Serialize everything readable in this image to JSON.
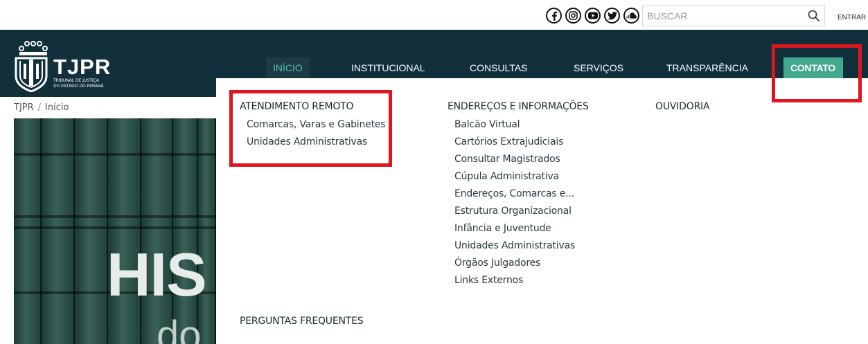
{
  "topbar": {
    "social_icons": [
      "facebook-icon",
      "instagram-icon",
      "youtube-icon",
      "twitter-icon",
      "soundcloud-icon"
    ],
    "search_placeholder": "BUSCAR",
    "login_label": "ENTRAR"
  },
  "header": {
    "logo_title": "TJPR",
    "logo_subtitle_line1": "TRIBUNAL DE JUSTIÇA",
    "logo_subtitle_line2": "DO ESTADO DO PARANÁ",
    "nav": [
      {
        "label": "INÍCIO",
        "active": true
      },
      {
        "label": "INSTITUCIONAL"
      },
      {
        "label": "CONSULTAS"
      },
      {
        "label": "SERVIÇOS"
      },
      {
        "label": "TRANSPARÊNCIA"
      },
      {
        "label": "CONTATO",
        "highlighted": true
      }
    ]
  },
  "breadcrumb": {
    "root": "TJPR",
    "separator": "/",
    "current": "Início"
  },
  "hero": {
    "text_big": "HIS",
    "text_small": "do"
  },
  "dropdown": {
    "columns": [
      {
        "heading": "ATENDIMENTO REMOTO",
        "links": [
          "Comarcas, Varas e Gabinetes",
          "Unidades Administrativas"
        ]
      },
      {
        "heading": "ENDEREÇOS E INFORMAÇÕES",
        "links": [
          "Balcão Virtual",
          "Cartórios Extrajudiciais",
          "Consultar Magistrados",
          "Cúpula Administrativa",
          "Endereços, Comarcas e...",
          "Estrutura Organizacional",
          "Infância e Juventude",
          "Unidades Administrativas",
          "Órgãos Julgadores",
          "Links Externos"
        ]
      },
      {
        "heading": "OUVIDORIA",
        "links": []
      }
    ],
    "bottom_heading": "PERGUNTAS FREQUENTES"
  },
  "colors": {
    "header_bg": "#12303c",
    "accent": "#42a98e",
    "active_text": "#55c3a5",
    "annotation": "#e1151f"
  }
}
